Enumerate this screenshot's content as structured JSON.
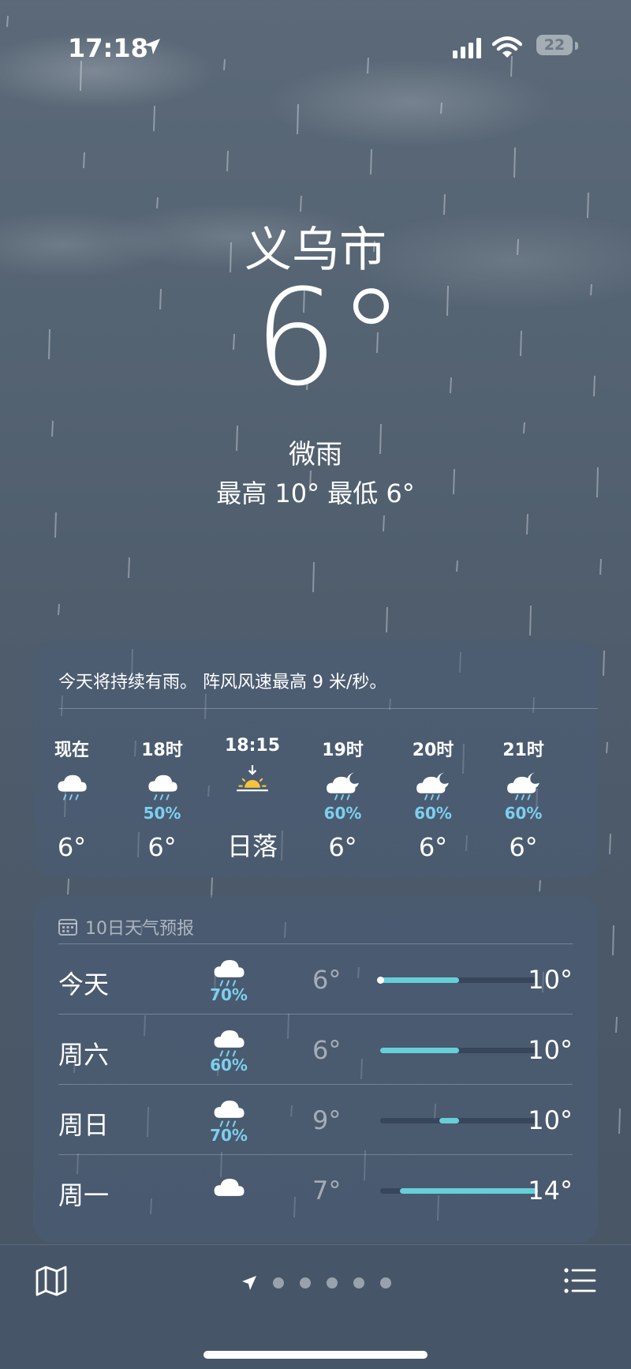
{
  "status_bar": {
    "time": "17:18",
    "battery": "22"
  },
  "location": {
    "city": "义乌市",
    "temperature": "6°",
    "condition": "微雨",
    "hi_lo": "最高 10°  最低 6°"
  },
  "hourly": {
    "summary": "今天将持续有雨。 阵风风速最高 9 米/秒。",
    "items": [
      {
        "label": "现在",
        "icon": "cloud-rain-icon",
        "pct": "",
        "value": "6°"
      },
      {
        "label": "18时",
        "icon": "cloud-rain-icon",
        "pct": "50%",
        "value": "6°"
      },
      {
        "label": "18:15",
        "icon": "sunset-icon",
        "pct": "",
        "value": "日落"
      },
      {
        "label": "19时",
        "icon": "cloud-moon-rain-icon",
        "pct": "60%",
        "value": "6°"
      },
      {
        "label": "20时",
        "icon": "cloud-moon-rain-icon",
        "pct": "60%",
        "value": "6°"
      },
      {
        "label": "21时",
        "icon": "cloud-moon-rain-icon",
        "pct": "60%",
        "value": "6°"
      }
    ]
  },
  "daily": {
    "header": "10日天气预报",
    "items": [
      {
        "name": "今天",
        "icon": "cloud-rain-icon",
        "pct": "70%",
        "lo": "6°",
        "hi": "10°"
      },
      {
        "name": "周六",
        "icon": "cloud-rain-icon",
        "pct": "60%",
        "lo": "6°",
        "hi": "10°"
      },
      {
        "name": "周日",
        "icon": "cloud-rain-icon",
        "pct": "70%",
        "lo": "9°",
        "hi": "10°"
      },
      {
        "name": "周一",
        "icon": "cloud-icon",
        "pct": "",
        "lo": "7°",
        "hi": "14°"
      }
    ]
  },
  "colors": {
    "accent_precip": "#7cd0ee",
    "temp_bar": "#66cfd8"
  }
}
